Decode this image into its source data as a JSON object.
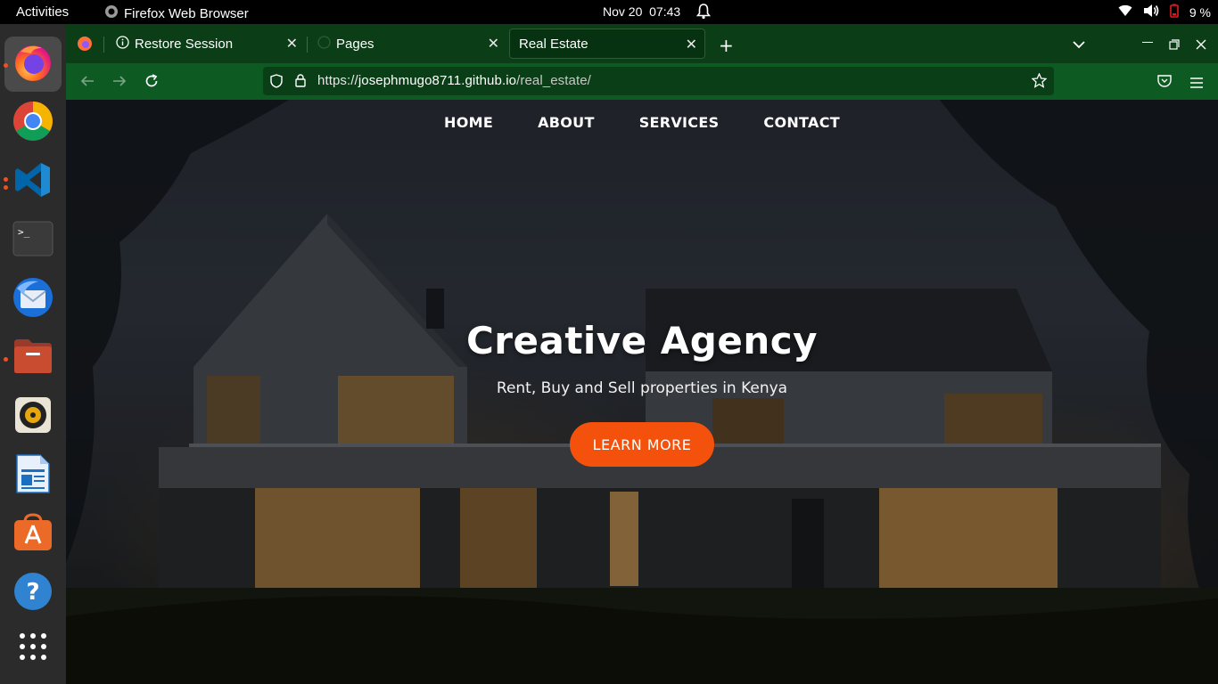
{
  "system_bar": {
    "activities": "Activities",
    "app_name": "Firefox Web Browser",
    "date": "Nov 20",
    "time": "07:43",
    "battery": "9 %"
  },
  "dock": {
    "items": [
      "firefox",
      "chrome",
      "vscode",
      "terminal",
      "thunderbird",
      "files",
      "rhythmbox",
      "libreoffice-writer",
      "software-center",
      "help",
      "app-grid"
    ],
    "accent_color": "#e95420"
  },
  "browser": {
    "tabs": [
      {
        "label": "Restore Session"
      },
      {
        "label": "Pages"
      },
      {
        "label": "Real Estate"
      }
    ],
    "url": {
      "scheme": "https://",
      "host": "josephmugo8711.github.io",
      "path": "/real_estate/"
    },
    "theme_color": "#0d5b22"
  },
  "site": {
    "nav": {
      "home": "HOME",
      "about": "ABOUT",
      "services": "SERVICES",
      "contact": "CONTACT"
    },
    "hero_title": "Creative Agency",
    "hero_subtitle": "Rent, Buy and Sell properties in Kenya",
    "cta_label": "LEARN MORE",
    "cta_color": "#f4520c"
  }
}
